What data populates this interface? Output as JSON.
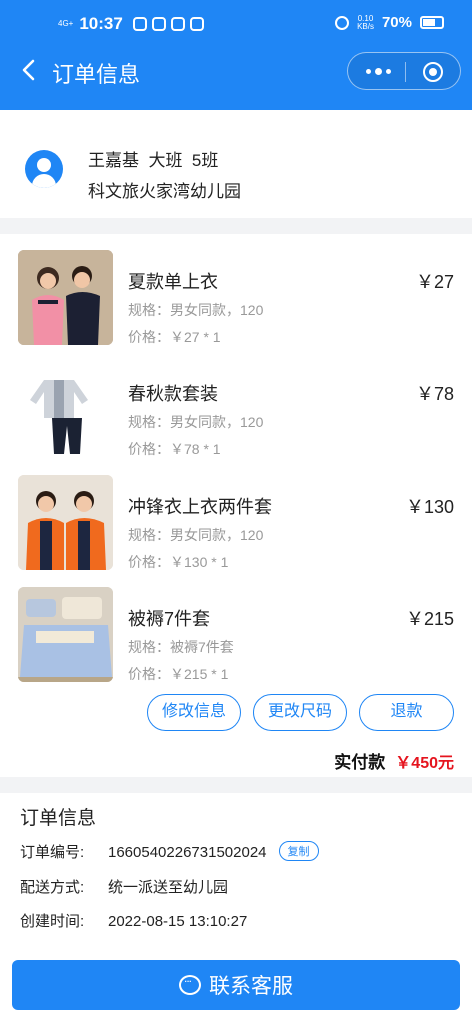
{
  "status_bar": {
    "network": "4G+",
    "time": "10:37",
    "speed_value": "0.10",
    "speed_unit": "KB/s",
    "battery": "70%"
  },
  "nav": {
    "title": "订单信息"
  },
  "student": {
    "info": "王嘉基  大班  5班",
    "school": "科文旅火家湾幼儿园"
  },
  "items": [
    {
      "name": "夏款单上衣",
      "spec": "规格：男女同款，120",
      "unit_price": "价格：￥27 * 1",
      "price": "￥27"
    },
    {
      "name": "春秋款套装",
      "spec": "规格：男女同款，120",
      "unit_price": "价格：￥78 * 1",
      "price": "￥78"
    },
    {
      "name": "冲锋衣上衣两件套",
      "spec": "规格：男女同款，120",
      "unit_price": "价格：￥130 * 1",
      "price": "￥130"
    },
    {
      "name": "被褥7件套",
      "spec": "规格：被褥7件套",
      "unit_price": "价格：￥215 * 1",
      "price": "￥215"
    }
  ],
  "actions": {
    "modify_info": "修改信息",
    "change_size": "更改尺码",
    "refund": "退款"
  },
  "total": {
    "label": "实付款",
    "amount": "￥450元"
  },
  "order_info": {
    "heading": "订单信息",
    "number_label": "订单编号:",
    "number": "1660540226731502024",
    "copy_label": "复制",
    "delivery_label": "配送方式:",
    "delivery": "统一派送至幼儿园",
    "created_label": "创建时间:",
    "created": "2022-08-15 13:10:27"
  },
  "service_button": {
    "label": "联系客服"
  },
  "colors": {
    "primary": "#1f86f5",
    "price_red": "#e5141e",
    "muted": "#999999"
  }
}
